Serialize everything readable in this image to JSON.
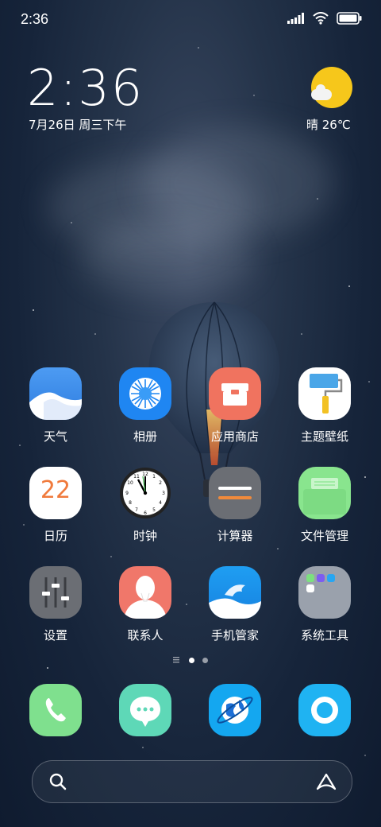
{
  "status_bar": {
    "time": "2:36"
  },
  "clock_widget": {
    "time": "2:36",
    "date": "7月26日 周三下午"
  },
  "weather": {
    "text": "晴 26℃"
  },
  "apps": [
    {
      "label": "天气"
    },
    {
      "label": "相册"
    },
    {
      "label": "应用商店"
    },
    {
      "label": "主题壁纸"
    },
    {
      "label": "日历",
      "day": "22"
    },
    {
      "label": "时钟"
    },
    {
      "label": "计算器"
    },
    {
      "label": "文件管理"
    },
    {
      "label": "设置"
    },
    {
      "label": "联系人"
    },
    {
      "label": "手机管家"
    },
    {
      "label": "系统工具"
    }
  ],
  "dock": [
    {
      "name": "phone"
    },
    {
      "name": "messages"
    },
    {
      "name": "browser"
    },
    {
      "name": "assistant"
    }
  ],
  "page_indicator": {
    "pages": 2,
    "active": 1
  }
}
